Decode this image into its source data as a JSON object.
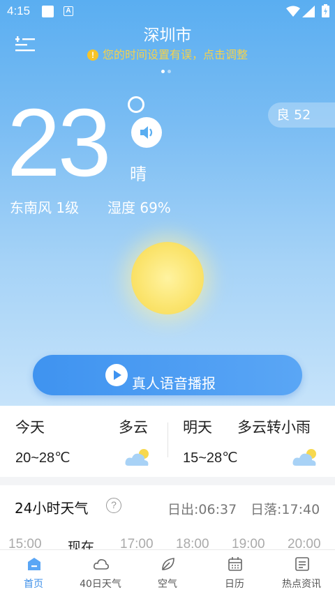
{
  "status_bar": {
    "time": "4:15",
    "a_label": "A"
  },
  "header": {
    "city": "深圳市",
    "warning": "您的时间设置有误，点击调整",
    "warning_icon": "!"
  },
  "current": {
    "temperature": "23",
    "condition": "晴",
    "wind": "东南风 1级",
    "humidity": "湿度 69%",
    "aqi": "良 52"
  },
  "broadcast": {
    "label": "真人语音播报"
  },
  "today": {
    "day": "今天",
    "condition": "多云",
    "range": "20~28℃"
  },
  "tomorrow": {
    "day": "明天",
    "condition": "多云转小雨",
    "range": "15~28℃"
  },
  "hourly": {
    "title": "24小时天气",
    "help": "?",
    "sunrise": "日出:06:37",
    "sunset": "日落:17:40",
    "times": [
      "15:00",
      "现在",
      "17:00",
      "18:00",
      "19:00",
      "20:00"
    ]
  },
  "nav": {
    "items": [
      {
        "label": "首页",
        "icon": "home-icon"
      },
      {
        "label": "40日天气",
        "icon": "cloud-icon"
      },
      {
        "label": "空气",
        "icon": "leaf-icon"
      },
      {
        "label": "日历",
        "icon": "calendar-icon"
      },
      {
        "label": "热点资讯",
        "icon": "news-icon"
      }
    ]
  },
  "colors": {
    "accent": "#3d8fe8",
    "warning": "#f6d24a",
    "sun": "#f7d84f"
  }
}
